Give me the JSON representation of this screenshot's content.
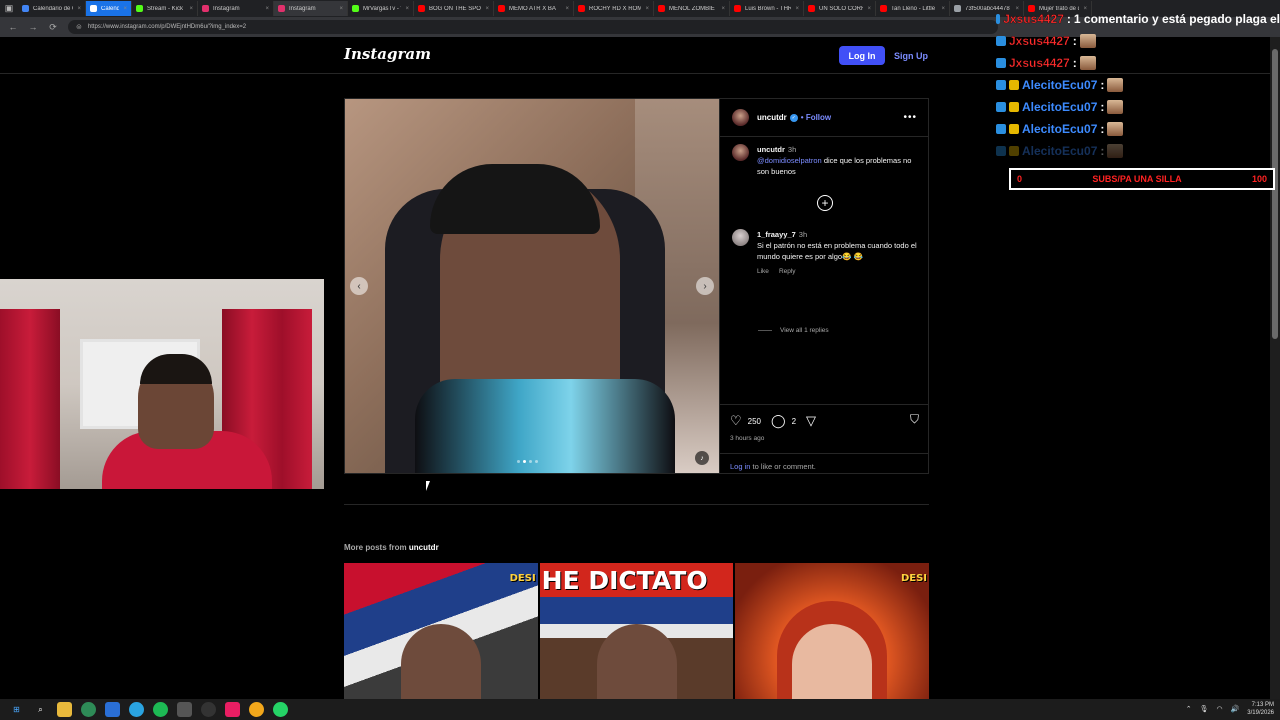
{
  "browser": {
    "tabs": [
      {
        "label": "Calendario de Go",
        "color": "#4285f4",
        "style": ""
      },
      {
        "label": "Calendar",
        "color": "#ffffff",
        "style": "active-blue"
      },
      {
        "label": "Stream - Kick Dash",
        "color": "#53fc18",
        "style": ""
      },
      {
        "label": "Instagram",
        "color": "#e1306c",
        "style": ""
      },
      {
        "label": "Instagram",
        "color": "#e1306c",
        "style": "current"
      },
      {
        "label": "MrVargasTv - Watc",
        "color": "#53fc18",
        "style": ""
      },
      {
        "label": "BOG ON THE SPOT",
        "color": "#ff0000",
        "style": ""
      },
      {
        "label": "MEMO ATR X BA",
        "color": "#ff0000",
        "style": ""
      },
      {
        "label": "ROCHY RD X ROM",
        "color": "#ff0000",
        "style": ""
      },
      {
        "label": "MENOL ZOMBIE",
        "color": "#ff0000",
        "style": ""
      },
      {
        "label": "Luis Brown - THRI",
        "color": "#ff0000",
        "style": ""
      },
      {
        "label": "UN SOLO CORRE",
        "color": "#ff0000",
        "style": ""
      },
      {
        "label": "Tan Lleno - Little",
        "color": "#ff0000",
        "style": ""
      },
      {
        "label": "73f500abc44478",
        "color": "#9aa0a6",
        "style": ""
      },
      {
        "label": "Mujer trató de qu",
        "color": "#ff0000",
        "style": ""
      }
    ],
    "url": "https://www.instagram.com/p/DWEjntHDm6u/?img_index=2"
  },
  "instagram": {
    "logo": "Instagram",
    "login_label": "Log In",
    "signup_label": "Sign Up",
    "post": {
      "username": "uncutdr",
      "follow_label": "Follow",
      "caption_user": "uncutdr",
      "caption_time": "3h",
      "caption_mention": "@domidioselpatron",
      "caption_text": " dice que los problemas no son buenos",
      "comment_user": "1_fraayy_7",
      "comment_time": "3h",
      "comment_text": "Si el patrón no está en problema cuando todo el mundo quiere es por algo😂 😂",
      "like_label": "Like",
      "reply_label": "Reply",
      "view_replies": "View all 1 replies",
      "likes_count": "250",
      "comments_count": "2",
      "time_ago": "3 hours ago",
      "login_link": "Log in",
      "login_rest": " to like or comment.",
      "carousel_active_index": 2,
      "carousel_count": 4
    },
    "more_posts_prefix": "More posts from",
    "more_posts_user": "uncutdr",
    "thumbs": [
      {
        "text": "DESI"
      },
      {
        "text": "HE DICTATO"
      },
      {
        "text": "DESI"
      }
    ]
  },
  "chat": {
    "lines": [
      {
        "name": "Jxsus4427",
        "name_color": "red",
        "message": "1 comentario y está pegado plaga el",
        "emote": false,
        "faded": false
      },
      {
        "name": "Jxsus4427",
        "name_color": "red",
        "message": "",
        "emote": true,
        "faded": false
      },
      {
        "name": "Jxsus4427",
        "name_color": "red",
        "message": "",
        "emote": true,
        "faded": false
      },
      {
        "name": "AlecitoEcu07",
        "name_color": "blue",
        "message": "",
        "emote": true,
        "faded": false
      },
      {
        "name": "AlecitoEcu07",
        "name_color": "blue",
        "message": "",
        "emote": true,
        "faded": false
      },
      {
        "name": "AlecitoEcu07",
        "name_color": "blue",
        "message": "",
        "emote": true,
        "faded": false
      },
      {
        "name": "AlecitoEcu07",
        "name_color": "blue",
        "message": "",
        "emote": true,
        "faded": true
      }
    ],
    "separator": ":"
  },
  "goal": {
    "left": "0",
    "label": "SUBS/PA UNA SILLA",
    "right": "100"
  },
  "taskbar": {
    "time": "7:13 PM",
    "date": "3/19/2026"
  },
  "colors": {
    "ig_blue": "#4150f7",
    "link": "#7b8cff",
    "goal_red": "#ff2222"
  }
}
